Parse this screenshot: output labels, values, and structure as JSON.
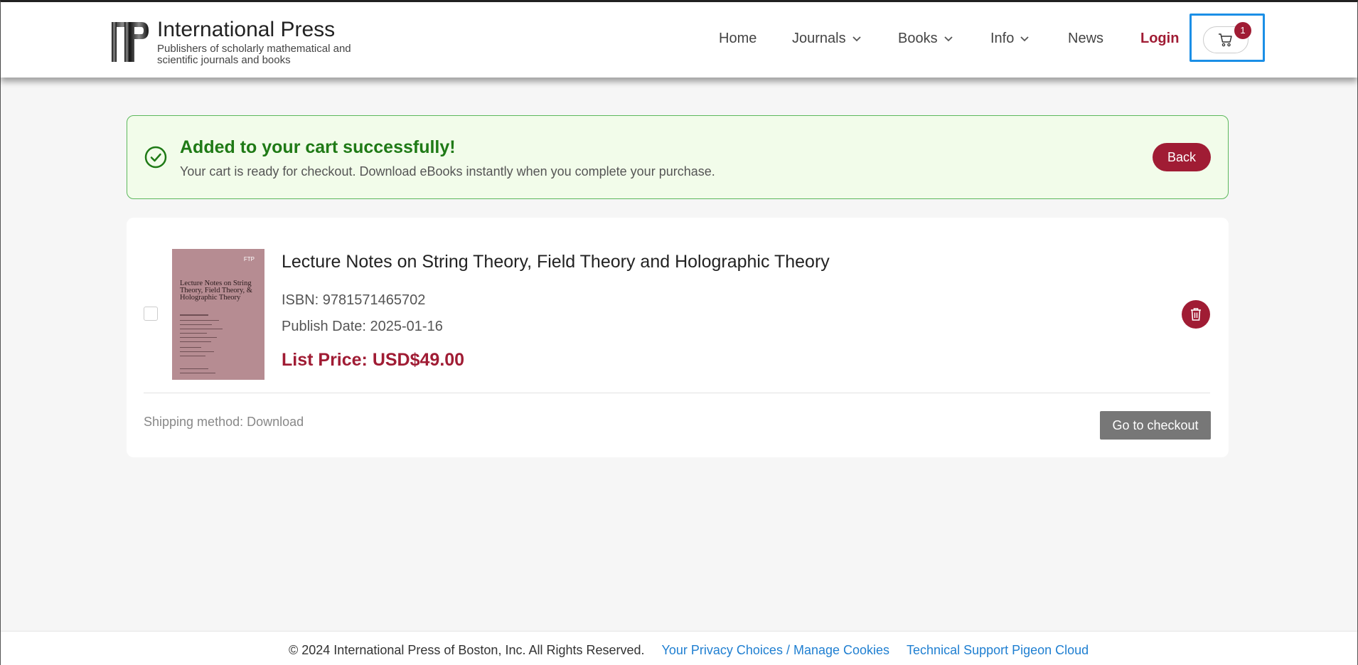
{
  "header": {
    "brand_title": "International Press",
    "brand_subtitle": "Publishers of scholarly mathematical and scientific journals and books",
    "logo_icon": "ip-logo",
    "nav": {
      "home": "Home",
      "journals": "Journals",
      "books": "Books",
      "info": "Info",
      "news": "News",
      "login": "Login"
    },
    "cart_icon": "cart-icon",
    "cart_count": "1"
  },
  "banner": {
    "icon": "check-circle-icon",
    "title": "Added to your cart successfully!",
    "text": "Your cart is ready for checkout. Download eBooks instantly when you complete your purchase.",
    "back_label": "Back"
  },
  "cart_item": {
    "title": "Lecture Notes on String Theory, Field Theory and Holographic Theory",
    "isbn": "ISBN: 9781571465702",
    "publish_date": "Publish Date: 2025-01-16",
    "price": "List Price: USD$49.00",
    "cover": {
      "brand": "FTP",
      "title": "Lecture Notes on String Theory, Field Theory, & Holographic Theory"
    },
    "delete_icon": "trash-icon"
  },
  "cart_footer": {
    "shipping": "Shipping method: Download",
    "checkout_label": "Go to checkout"
  },
  "footer": {
    "copyright": "© 2024 International Press of Boston, Inc. All Rights Reserved.",
    "privacy_link": "Your Privacy Choices / Manage Cookies",
    "support_link": "Technical Support Pigeon Cloud"
  },
  "colors": {
    "accent": "#a01c34",
    "success": "#1f7a16",
    "link": "#1f7fd1",
    "focus": "#1b8fe6"
  }
}
